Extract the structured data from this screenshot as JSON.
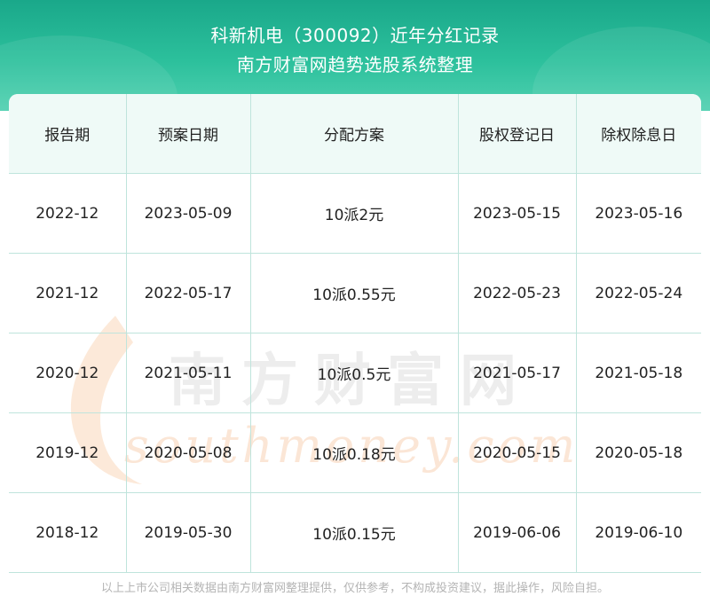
{
  "header": {
    "title": "科新机电（300092）近年分红记录",
    "subtitle": "南方财富网趋势选股系统整理"
  },
  "table": {
    "columns": [
      "报告期",
      "预案日期",
      "分配方案",
      "股权登记日",
      "除权除息日"
    ],
    "rows": [
      [
        "2022-12",
        "2023-05-09",
        "10派2元",
        "2023-05-15",
        "2023-05-16"
      ],
      [
        "2021-12",
        "2022-05-17",
        "10派0.55元",
        "2022-05-23",
        "2022-05-24"
      ],
      [
        "2020-12",
        "2021-05-11",
        "10派0.5元",
        "2021-05-17",
        "2021-05-18"
      ],
      [
        "2019-12",
        "2020-05-08",
        "10派0.18元",
        "2020-05-15",
        "2020-05-18"
      ],
      [
        "2018-12",
        "2019-05-30",
        "10派0.15元",
        "2019-06-06",
        "2019-06-10"
      ]
    ]
  },
  "watermark": {
    "cn": "南方财富网",
    "en": "southmoney.com"
  },
  "footer": {
    "disclaimer": "以上上市公司相关数据由南方财富网整理提供，仅供参考，不构成投资建议，据此操作，风险自担。"
  },
  "colors": {
    "header_green": "#1aa88a",
    "table_header_bg": "#effaf7",
    "grid_line": "#bfe4dc"
  }
}
